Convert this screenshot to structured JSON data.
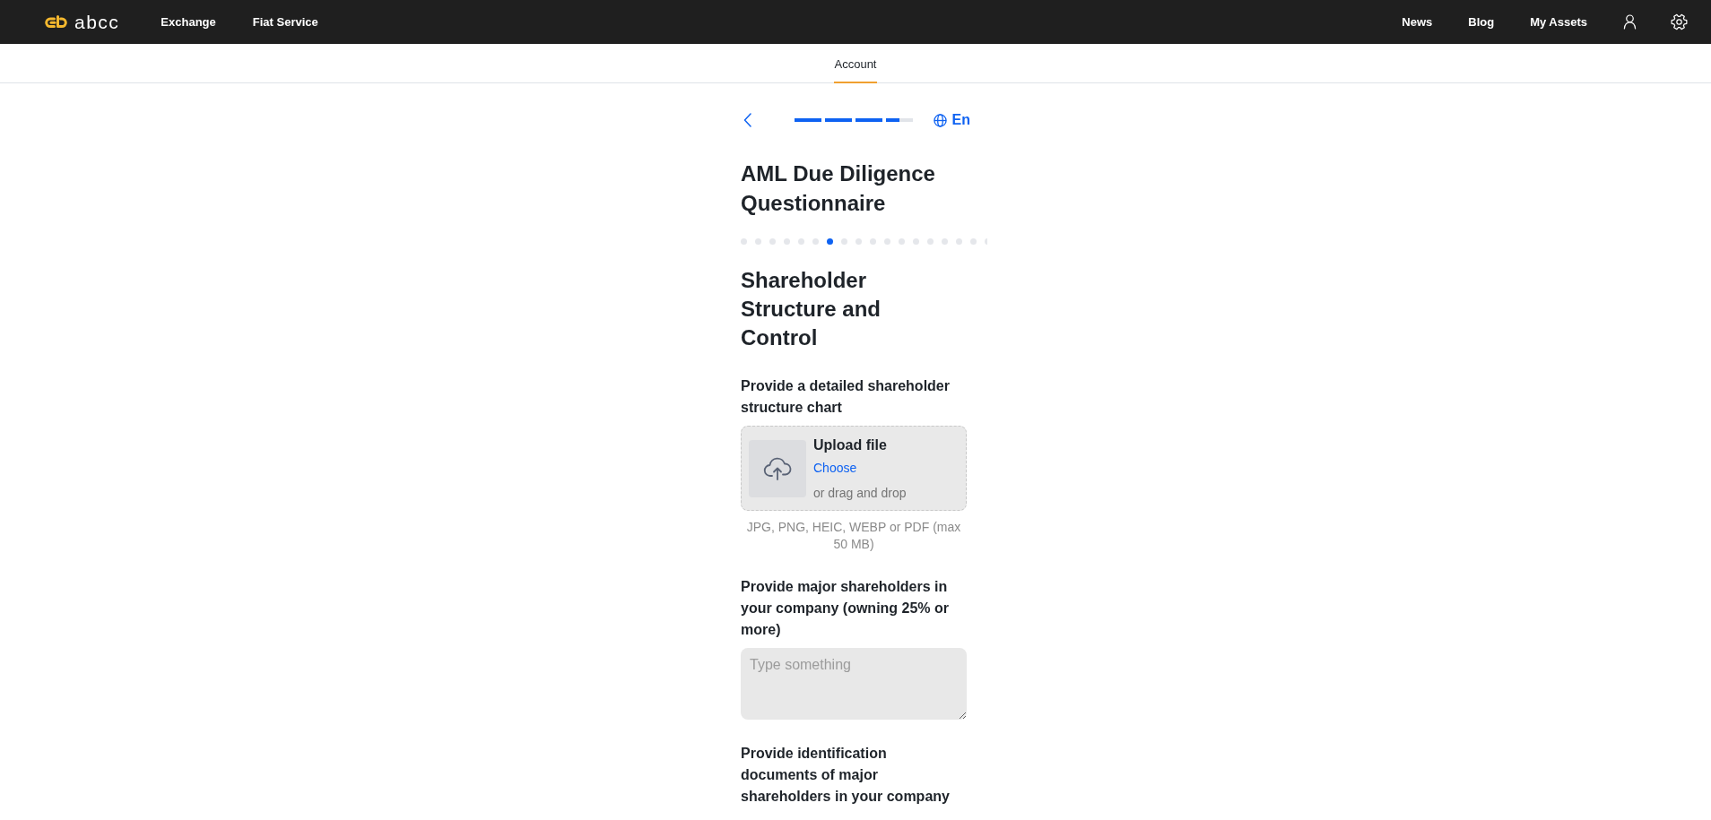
{
  "top_nav": {
    "logo": {
      "text": "abcc"
    },
    "links_left": [
      {
        "label": "Exchange"
      },
      {
        "label": "Fiat Service"
      }
    ],
    "links_right": [
      {
        "label": "News"
      },
      {
        "label": "Blog"
      },
      {
        "label": "My Assets"
      }
    ]
  },
  "tabs": [
    {
      "label": "Account",
      "selected": true
    }
  ],
  "form_header": {
    "progress": {
      "level": 0.89
    },
    "language": "En"
  },
  "title": "AML Due Diligence Questionnaire",
  "steps": [
    {
      "selected": false
    },
    {
      "selected": false
    },
    {
      "selected": false
    },
    {
      "selected": false
    },
    {
      "selected": false
    },
    {
      "selected": false
    },
    {
      "selected": true
    },
    {
      "selected": false
    },
    {
      "selected": false
    },
    {
      "selected": false
    },
    {
      "selected": false
    },
    {
      "selected": false
    },
    {
      "selected": false
    },
    {
      "selected": false
    },
    {
      "selected": false
    },
    {
      "selected": false
    },
    {
      "selected": false
    },
    {
      "selected": false
    }
  ],
  "section": {
    "heading": "Shareholder Structure and Control",
    "questions": [
      {
        "kind": "upload",
        "label": "Provide a detailed shareholder structure chart",
        "upload": {
          "title": "Upload file",
          "link": "Choose",
          "alt": "or drag and drop"
        },
        "hint": "JPG, PNG, HEIC, WEBP or PDF (max 50 MB)"
      },
      {
        "kind": "textarea",
        "label": "Provide major shareholders in your company (owning 25% or more)",
        "placeholder": "Type something"
      },
      {
        "label": "Provide identification documents of major shareholders in your company"
      }
    ]
  }
}
